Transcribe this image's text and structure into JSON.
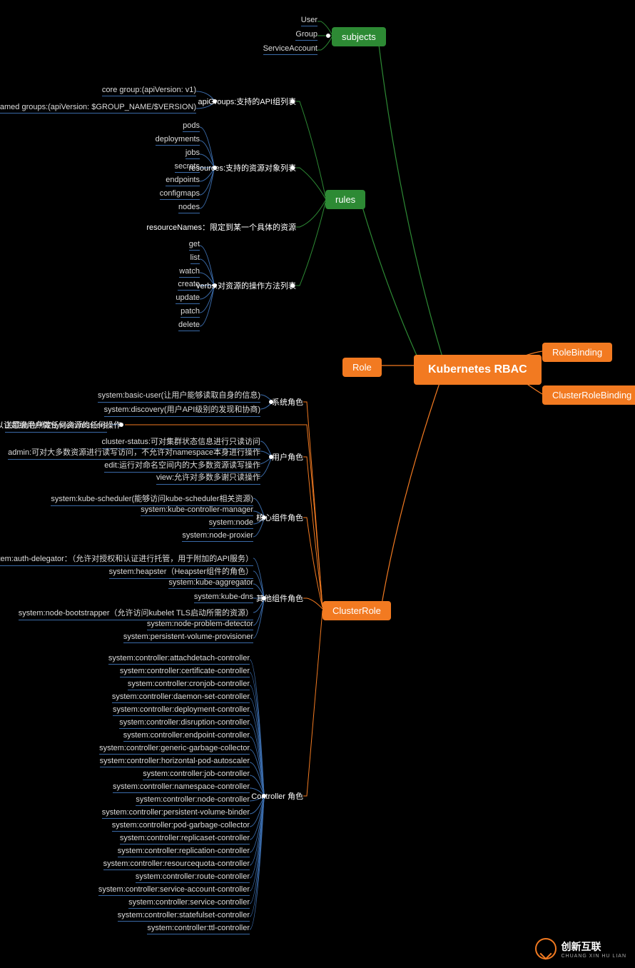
{
  "root": "Kubernetes RBAC",
  "main_branches": {
    "subjects": "subjects",
    "rules": "rules",
    "role": "Role",
    "clusterrole": "ClusterRole",
    "rolebinding": "RoleBinding",
    "clusterrolebinding": "ClusterRoleBinding"
  },
  "subjects_children": [
    "User",
    "Group",
    "ServiceAccount"
  ],
  "rules_children": {
    "apiGroups": {
      "label": "apiGroups:支持的API组列表",
      "items": [
        "core group:(apiVersion: v1)",
        "named groups:(apiVersion: $GROUP_NAME/$VERSION)"
      ]
    },
    "resources": {
      "label": "resources:支持的资源对象列表",
      "items": [
        "pods",
        "deployments",
        "jobs",
        "secrets",
        "endpoints",
        "configmaps",
        "nodes"
      ]
    },
    "resourceNames": {
      "label": "resourceNames：限定到某一个具体的资源"
    },
    "verbs": {
      "label": "verbs:对资源的操作方法列表",
      "items": [
        "get",
        "list",
        "watch",
        "create",
        "update",
        "patch",
        "delete"
      ]
    }
  },
  "clusterrole_children": {
    "system_roles": {
      "label": "系统角色",
      "items": [
        "system:basic-user(让用户能够读取自身的信息)",
        "system:discovery(用户API级别的发现和协商)"
      ]
    },
    "cluster_admin": {
      "label": "cluster-admin:可以让超级用户做任何资源的任何操作",
      "sub": "关联角色绑定system:masters"
    },
    "user_roles": {
      "label": "用户角色",
      "items": [
        "cluster-status:可对集群状态信息进行只读访问",
        "admin:可对大多数资源进行读写访问，不允许对namespace本身进行操作",
        "edit:运行对命名空间内的大多数资源读写操作",
        "view:允许对多数多谢只读操作"
      ]
    },
    "core_roles": {
      "label": "核心组件角色",
      "items": [
        "system:kube-scheduler(能够访问kube-scheduler相关资源)",
        "system:kube-controller-manager",
        "system:node",
        "system:node-proxier"
      ]
    },
    "other_roles": {
      "label": "其他组件角色",
      "items": [
        "system:auth-delegator：（允许对授权和认证进行托管，用于附加的API服务）",
        "system:heapster（Heapster组件的角色）",
        "system:kube-aggregator",
        "system:kube-dns",
        "system:node-bootstrapper（允许访问kubelet TLS启动所需的资源）",
        "system:node-problem-detector",
        "system:persistent-volume-provisioner"
      ]
    },
    "controller_roles": {
      "label": "Controller 角色",
      "items": [
        "system:controller:attachdetach-controller",
        "system:controller:certificate-controller",
        "system:controller:cronjob-controller",
        "system:controller:daemon-set-controller",
        "system:controller:deployment-controller",
        "system:controller:disruption-controller",
        "system:controller:endpoint-controller",
        "system:controller:generic-garbage-collector",
        "system:controller:horizontal-pod-autoscaler",
        "system:controller:job-controller",
        "system:controller:namespace-controller",
        "system:controller:node-controller",
        "system:controller:persistent-volume-binder",
        "system:controller:pod-garbage-collector",
        "system:controller:replicaset-controller",
        "system:controller:replication-controller",
        "system:controller:resourcequota-controller",
        "system:controller:route-controller",
        "system:controller:service-account-controller",
        "system:controller:service-controller",
        "system:controller:statefulset-controller",
        "system:controller:ttl-controller"
      ]
    }
  },
  "logo": {
    "main": "创新互联",
    "sub": "CHUANG XIN HU LIAN"
  }
}
